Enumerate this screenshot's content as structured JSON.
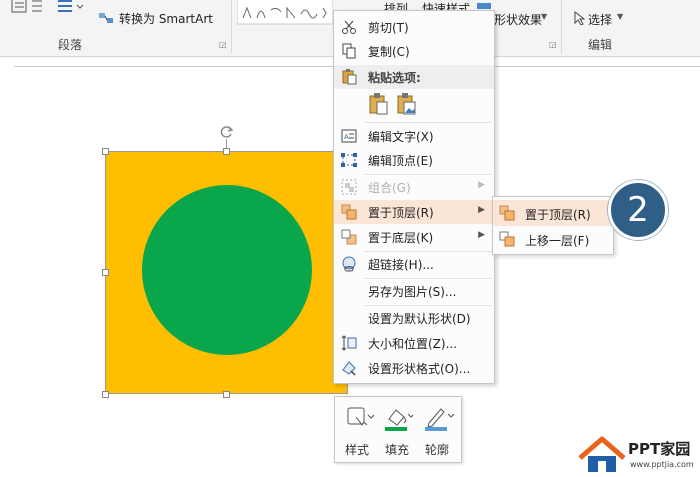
{
  "ribbon": {
    "convert_smartart": "转换为 SmartArt",
    "paragraph_label": "段落",
    "arrange_label": "排列",
    "quick_styles_label": "快速样式",
    "shape_effects_label": "形状效果",
    "select_label": "选择",
    "edit_label": "编辑"
  },
  "context_menu": {
    "items": [
      {
        "label": "剪切(T)",
        "icon": "scissors-icon"
      },
      {
        "label": "复制(C)",
        "icon": "copy-icon"
      },
      {
        "label": "粘贴选项:",
        "icon": "paste-icon"
      },
      {
        "label": "编辑文字(X)",
        "icon": "edit-text-icon"
      },
      {
        "label": "编辑顶点(E)",
        "icon": "edit-points-icon"
      },
      {
        "label": "组合(G)",
        "icon": "group-icon",
        "disabled": true
      },
      {
        "label": "置于顶层(R)",
        "icon": "bring-to-front-icon"
      },
      {
        "label": "置于底层(K)",
        "icon": "send-to-back-icon"
      },
      {
        "label": "超链接(H)...",
        "icon": "hyperlink-icon"
      },
      {
        "label": "另存为图片(S)..."
      },
      {
        "label": "设置为默认形状(D)"
      },
      {
        "label": "大小和位置(Z)...",
        "icon": "size-position-icon"
      },
      {
        "label": "设置形状格式(O)...",
        "icon": "format-shape-icon"
      }
    ]
  },
  "submenu": {
    "items": [
      {
        "label": "置于顶层(R)",
        "icon": "bring-to-front-icon"
      },
      {
        "label": "上移一层(F)",
        "icon": "bring-forward-icon"
      }
    ]
  },
  "step_badge": "2",
  "mini_toolbar": {
    "style_label": "样式",
    "fill_label": "填充",
    "outline_label": "轮廓"
  },
  "watermark": {
    "brand": "PPT家园",
    "url": "www.pptjia.com"
  },
  "colors": {
    "square_fill": "#ffbf00",
    "circle_fill": "#0aa64b",
    "menu_hover": "#fbe5d6",
    "badge": "#2f5e86"
  }
}
